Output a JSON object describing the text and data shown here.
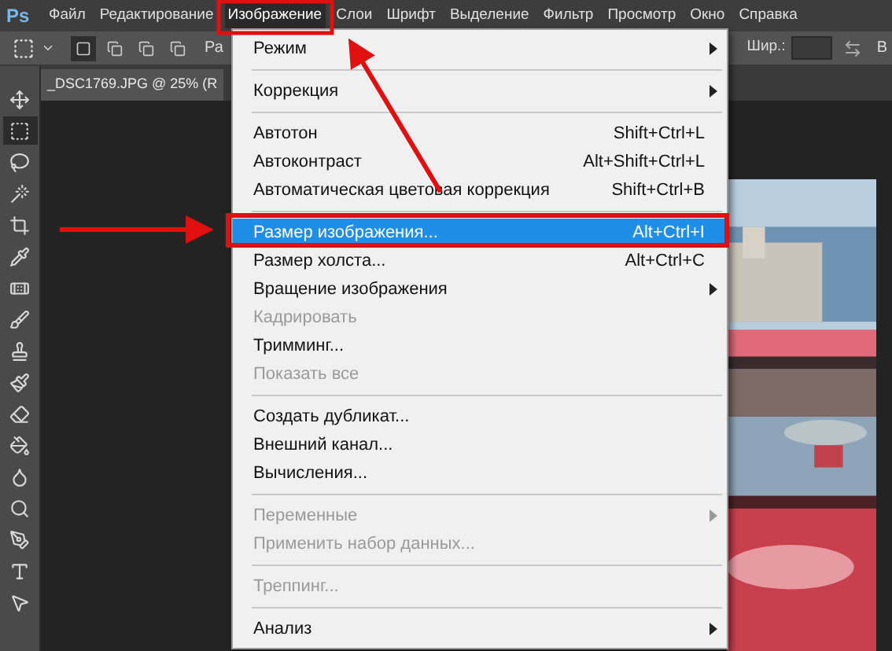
{
  "app_logo": "Ps",
  "menu_bar": [
    {
      "label": "Файл",
      "selected": false
    },
    {
      "label": "Редактирование",
      "selected": false
    },
    {
      "label": "Изображение",
      "selected": true
    },
    {
      "label": "Слои",
      "selected": false
    },
    {
      "label": "Шрифт",
      "selected": false
    },
    {
      "label": "Выделение",
      "selected": false
    },
    {
      "label": "Фильтр",
      "selected": false
    },
    {
      "label": "Просмотр",
      "selected": false
    },
    {
      "label": "Окно",
      "selected": false
    },
    {
      "label": "Справка",
      "selected": false
    }
  ],
  "options_bar": {
    "modes": [
      {
        "selected": true
      },
      {
        "selected": false
      },
      {
        "selected": false
      },
      {
        "selected": false
      }
    ],
    "text_1": "Ра",
    "width_label": "Шир.:",
    "text_2": "В"
  },
  "document_tab": {
    "title": "_DSC1769.JPG @ 25% (R"
  },
  "tools": [
    {
      "selected": false
    },
    {
      "selected": true
    },
    {
      "selected": false
    },
    {
      "selected": false
    },
    {
      "selected": false
    },
    {
      "selected": false
    },
    {
      "selected": false
    },
    {
      "selected": false
    },
    {
      "selected": false
    },
    {
      "selected": false
    },
    {
      "selected": false
    },
    {
      "selected": false
    },
    {
      "selected": false
    },
    {
      "selected": false
    },
    {
      "selected": false
    },
    {
      "selected": false
    },
    {
      "selected": false
    }
  ],
  "image_menu": [
    {
      "kind": "item",
      "label": "Режим",
      "submenu": true,
      "disabled": false,
      "selected": false
    },
    {
      "kind": "separator"
    },
    {
      "kind": "item",
      "label": "Коррекция",
      "submenu": true,
      "disabled": false,
      "selected": false
    },
    {
      "kind": "separator"
    },
    {
      "kind": "item",
      "label": "Автотон",
      "shortcut": "Shift+Ctrl+L",
      "disabled": false,
      "selected": false
    },
    {
      "kind": "item",
      "label": "Автоконтраст",
      "shortcut": "Alt+Shift+Ctrl+L",
      "disabled": false,
      "selected": false
    },
    {
      "kind": "item",
      "label": "Автоматическая цветовая коррекция",
      "shortcut": "Shift+Ctrl+B",
      "disabled": false,
      "selected": false
    },
    {
      "kind": "separator"
    },
    {
      "kind": "item",
      "label": "Размер изображения...",
      "shortcut": "Alt+Ctrl+I",
      "disabled": false,
      "selected": true
    },
    {
      "kind": "item",
      "label": "Размер холста...",
      "shortcut": "Alt+Ctrl+C",
      "disabled": false,
      "selected": false
    },
    {
      "kind": "item",
      "label": "Вращение изображения",
      "submenu": true,
      "disabled": false,
      "selected": false
    },
    {
      "kind": "item",
      "label": "Кадрировать",
      "disabled": true,
      "selected": false
    },
    {
      "kind": "item",
      "label": "Тримминг...",
      "disabled": false,
      "selected": false
    },
    {
      "kind": "item",
      "label": "Показать все",
      "disabled": true,
      "selected": false
    },
    {
      "kind": "separator"
    },
    {
      "kind": "item",
      "label": "Создать дубликат...",
      "disabled": false,
      "selected": false
    },
    {
      "kind": "item",
      "label": "Внешний канал...",
      "disabled": false,
      "selected": false
    },
    {
      "kind": "item",
      "label": "Вычисления...",
      "disabled": false,
      "selected": false
    },
    {
      "kind": "separator"
    },
    {
      "kind": "item",
      "label": "Переменные",
      "submenu": true,
      "disabled": true,
      "selected": false
    },
    {
      "kind": "item",
      "label": "Применить набор данных...",
      "disabled": true,
      "selected": false
    },
    {
      "kind": "separator"
    },
    {
      "kind": "item",
      "label": "Треппинг...",
      "disabled": true,
      "selected": false
    },
    {
      "kind": "separator"
    },
    {
      "kind": "item",
      "label": "Анализ",
      "submenu": true,
      "disabled": false,
      "selected": false
    }
  ]
}
